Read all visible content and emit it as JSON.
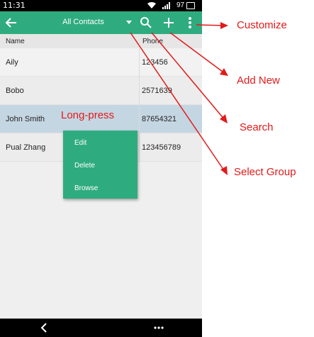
{
  "status_bar": {
    "time": "11:31",
    "battery": "97"
  },
  "app_bar": {
    "title": "All Contacts"
  },
  "table": {
    "headers": {
      "name": "Name",
      "phone": "Phone"
    },
    "rows": [
      {
        "name": "Aily",
        "phone": "123456"
      },
      {
        "name": "Bobo",
        "phone": "2571639"
      },
      {
        "name": "John Smith",
        "phone": "87654321"
      },
      {
        "name": "Pual Zhang",
        "phone": "123456789"
      }
    ]
  },
  "context_menu": {
    "items": [
      "Edit",
      "Delete",
      "Browse"
    ]
  },
  "annotations": {
    "long_press": "Long-press",
    "customize": "Customize",
    "add_new": "Add New",
    "search": "Search",
    "select_group": "Select Group"
  },
  "colors": {
    "accent": "#2fac7f",
    "annotation": "#e11a1a",
    "selected_row": "#c5d6e3"
  }
}
